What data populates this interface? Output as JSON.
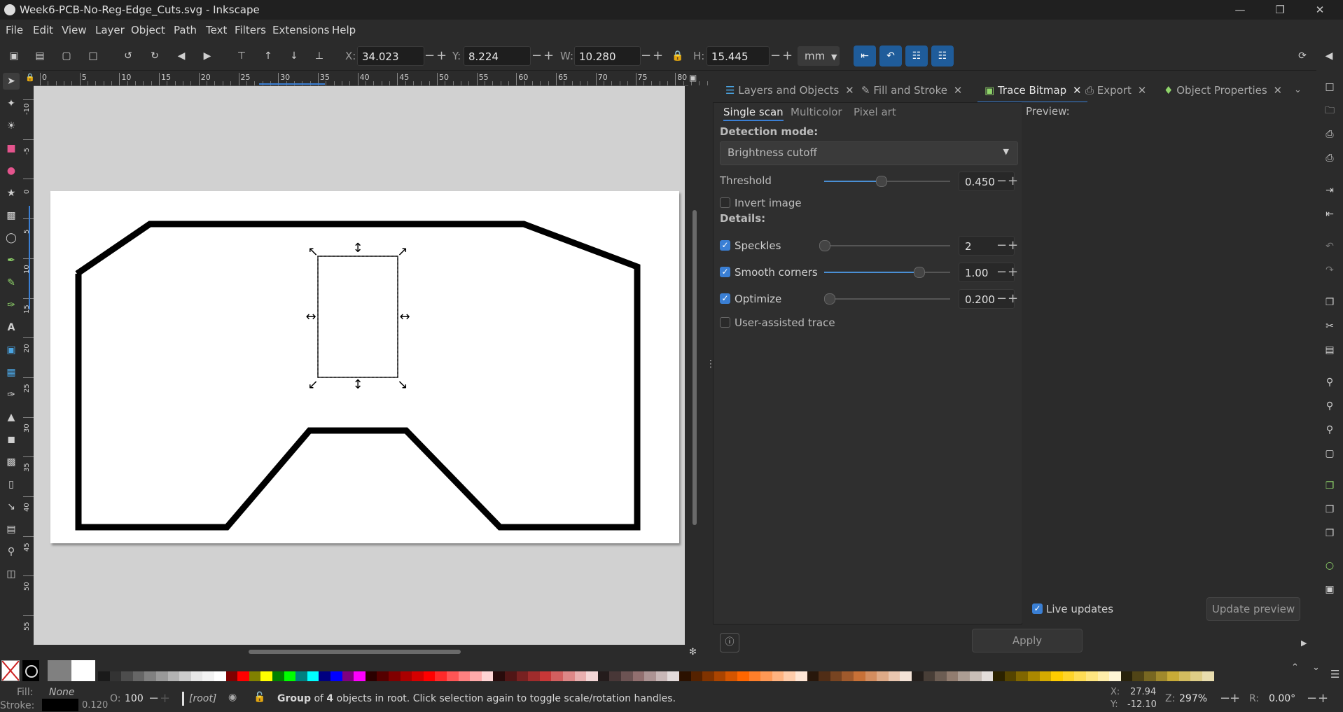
{
  "window": {
    "title": "Week6-PCB-No-Reg-Edge_Cuts.svg - Inkscape"
  },
  "menu": [
    "File",
    "Edit",
    "View",
    "Layer",
    "Object",
    "Path",
    "Text",
    "Filters",
    "Extensions",
    "Help"
  ],
  "toolctrl": {
    "x_label": "X:",
    "x_value": "34.023",
    "y_label": "Y:",
    "y_value": "8.224",
    "w_label": "W:",
    "w_value": "10.280",
    "h_label": "H:",
    "h_value": "15.445",
    "unit": "mm"
  },
  "hruler_labels": [
    "0",
    "5",
    "10",
    "15",
    "20",
    "25",
    "30",
    "35",
    "40",
    "45",
    "50",
    "55",
    "60",
    "65",
    "70",
    "75",
    "80"
  ],
  "vruler_labels": [
    "-10",
    "-5",
    "0",
    "5",
    "10",
    "15",
    "20",
    "25",
    "30",
    "35",
    "40",
    "45",
    "50",
    "55"
  ],
  "dock": {
    "tabs": [
      "Layers and Objects",
      "Fill and Stroke",
      "Trace Bitmap",
      "Export",
      "Object Properties"
    ],
    "active_tab": "Trace Bitmap"
  },
  "trace": {
    "modes": [
      "Single scan",
      "Multicolor",
      "Pixel art"
    ],
    "detection_label": "Detection mode:",
    "detection_value": "Brightness cutoff",
    "threshold_label": "Threshold",
    "threshold_value": "0.450",
    "threshold_fraction": 0.45,
    "invert_label": "Invert image",
    "details_label": "Details:",
    "speckles_label": "Speckles",
    "speckles_value": "2",
    "speckles_fraction": 0.0,
    "smooth_label": "Smooth corners",
    "smooth_value": "1.00",
    "smooth_fraction": 0.75,
    "optimize_label": "Optimize",
    "optimize_value": "0.200",
    "optimize_fraction": 0.04,
    "user_assisted_label": "User-assisted trace",
    "preview_label": "Preview:",
    "live_updates_label": "Live updates",
    "update_preview_label": "Update preview",
    "apply_label": "Apply"
  },
  "status": {
    "fill_label": "Fill:",
    "fill_value": "None",
    "stroke_label": "Stroke:",
    "stroke_width": "0.120",
    "opacity_label": "O:",
    "opacity_value": "100",
    "layer": "[root]",
    "message_bold": "Group",
    "message_pre": " of ",
    "message_count": "4",
    "message_rest": " objects in root. Click selection again to toggle scale/rotation handles.",
    "cursor_x_label": "X:",
    "cursor_x": "27.94",
    "cursor_y_label": "Y:",
    "cursor_y": "-12.10",
    "zoom_label": "Z:",
    "zoom": "297%",
    "rotate_label": "R:",
    "rotate": "0.00°"
  },
  "colors": {
    "accent": "#3a7fd4",
    "canvas_bg": "#d1d1d1"
  }
}
